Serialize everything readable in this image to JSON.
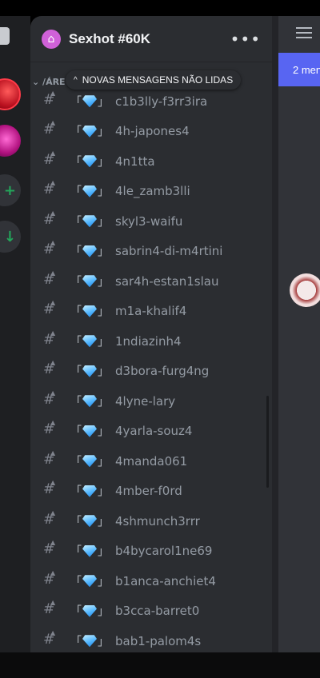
{
  "guild": {
    "name": "Sexhot #60K",
    "more_label": "•••"
  },
  "category": {
    "label": "ÁRE"
  },
  "new_messages": {
    "label": "NOVAS MENSAGENS NÃO LIDAS"
  },
  "channel_prefix": {
    "open": "「",
    "close": "」"
  },
  "channels": [
    {
      "name": "c1b3lly-f3rr3ira"
    },
    {
      "name": "4h-japones4"
    },
    {
      "name": "4n1tta"
    },
    {
      "name": "4le_zamb3lli"
    },
    {
      "name": "skyl3-waifu"
    },
    {
      "name": "sabrin4-di-m4rtini"
    },
    {
      "name": "sar4h-estan1slau"
    },
    {
      "name": "m1a-khalif4"
    },
    {
      "name": "1ndiazinh4"
    },
    {
      "name": "d3bora-furg4ng"
    },
    {
      "name": "4lyne-lary"
    },
    {
      "name": "4yarla-souz4"
    },
    {
      "name": "4manda061"
    },
    {
      "name": "4mber-f0rd"
    },
    {
      "name": "4shmunch3rrr"
    },
    {
      "name": "b4bycarol1ne69"
    },
    {
      "name": "b1anca-anchiet4"
    },
    {
      "name": "b3cca-barret0"
    },
    {
      "name": "bab1-palom4s"
    }
  ],
  "chat": {
    "unread_banner": "2 men"
  },
  "icons": {
    "guild": "home-icon",
    "menu": "hamburger-menu-icon",
    "channel": "locked-text-channel-icon",
    "gem": "gem-icon"
  },
  "colors": {
    "sidebar": "#2b2d31",
    "chat": "#313338",
    "rail": "#1e1f22",
    "accent": "#5865f2",
    "guild_icon": "#d061d8",
    "muted_text": "#949ba4"
  }
}
